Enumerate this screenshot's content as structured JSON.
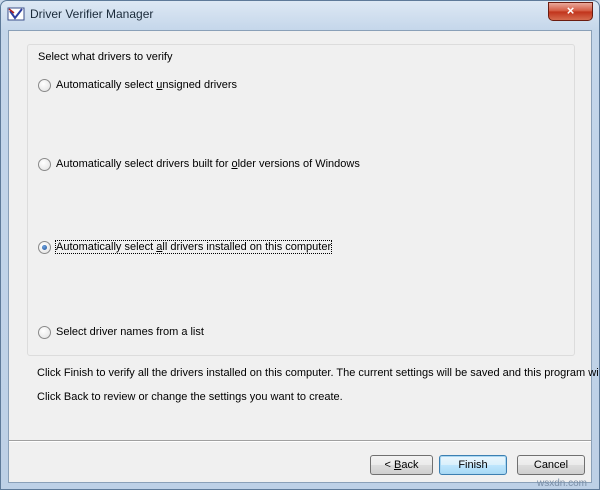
{
  "window": {
    "title": "Driver Verifier Manager",
    "close_glyph": "×"
  },
  "group": {
    "label": "Select what drivers to verify",
    "options": [
      {
        "pre": "Automatically select ",
        "key": "u",
        "post": "nsigned drivers",
        "checked": false
      },
      {
        "pre": "Automatically select drivers built for ",
        "key": "o",
        "post": "lder versions of Windows",
        "checked": false
      },
      {
        "pre": "Automatically select ",
        "key": "a",
        "post": "ll drivers installed on this computer",
        "checked": true
      },
      {
        "pre": "Select driver names from a list",
        "key": "",
        "post": "",
        "checked": false
      }
    ]
  },
  "info": {
    "line1": "Click Finish to verify all the drivers installed on this computer. The current settings will be saved and this program will exit.",
    "line2": "Click Back to review or change the settings you want to create."
  },
  "buttons": {
    "back_arrow": "< ",
    "back_key": "B",
    "back_rest": "ack",
    "finish": "Finish",
    "cancel": "Cancel"
  },
  "watermark": "wsxdn.com",
  "colors": {
    "accent": "#3c7fb1",
    "radio_dot": "#1c4f96",
    "close": "#c0321a"
  }
}
